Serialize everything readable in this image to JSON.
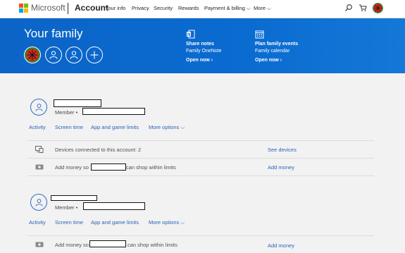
{
  "header": {
    "brand": "Microsoft",
    "section": "Account",
    "nav": [
      {
        "label": "Your info"
      },
      {
        "label": "Privacy"
      },
      {
        "label": "Security"
      },
      {
        "label": "Rewards"
      },
      {
        "label": "Payment & billing ⌵"
      },
      {
        "label": "More ⌵"
      }
    ],
    "icons": [
      "search-icon",
      "cart-icon",
      "profile-avatar"
    ],
    "logo_colors": [
      "#f25022",
      "#7fba00",
      "#00a4ef",
      "#ffb900"
    ]
  },
  "banner": {
    "title": "Your family",
    "background": "#0c64c7",
    "features": [
      {
        "icon": "onenote-icon",
        "title": "Share notes",
        "subtitle": "Family OneNote",
        "link": "Open now ›"
      },
      {
        "icon": "calendar-icon",
        "title": "Plan family events",
        "subtitle": "Family calendar",
        "link": "Open now ›"
      }
    ]
  },
  "members": [
    {
      "role_label": "Member •",
      "tabs": [
        "Activity",
        "Screen time",
        "App and game limits",
        "More options ⌵"
      ],
      "rows": [
        {
          "icon": "devices-icon",
          "text": "Devices connected to this account: 2",
          "link": "See devices"
        },
        {
          "icon": "money-icon",
          "text_before": "Add money so",
          "text_after": "can shop within limits",
          "link": "Add money"
        }
      ]
    },
    {
      "role_label": "Member •",
      "tabs": [
        "Activity",
        "Screen time",
        "App and game limits",
        "More options ⌵"
      ],
      "rows": [
        {
          "icon": "money-icon",
          "text_before": "Add money so",
          "text_after": "can shop within limits",
          "link": "Add money"
        }
      ]
    }
  ]
}
